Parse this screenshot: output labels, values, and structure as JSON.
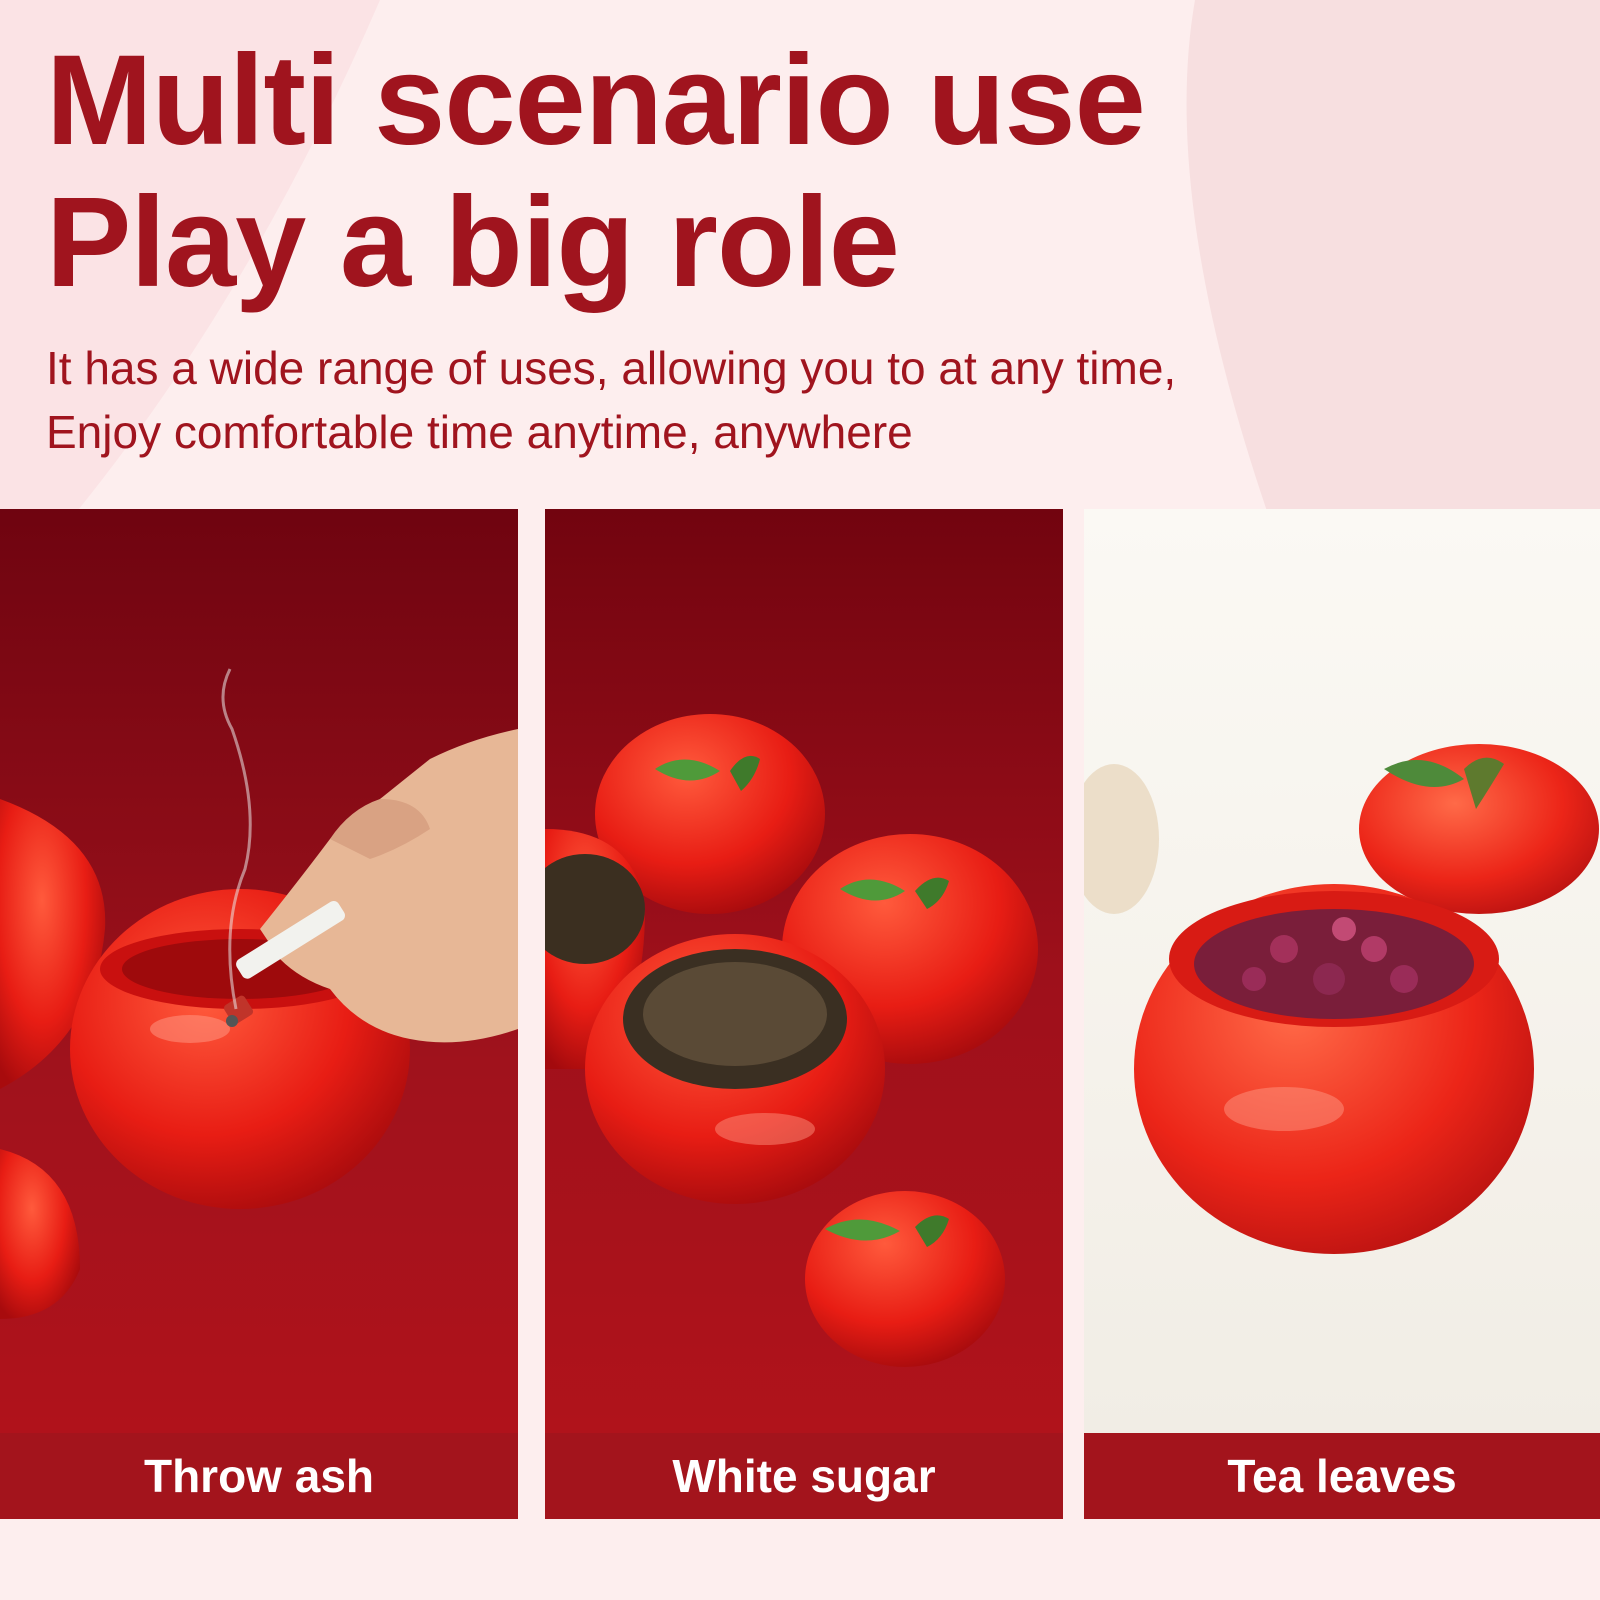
{
  "header": {
    "title_lines": [
      "Multi scenario use",
      "Play a big role"
    ],
    "subtitle_lines": [
      "It has a wide range of uses, allowing you to at any time,",
      "Enjoy comfortable time anytime, anywhere"
    ]
  },
  "panels": [
    {
      "caption": "Throw ash",
      "image": "red-apple-jar-ashtray-with-cigarette-photo"
    },
    {
      "caption": "White sugar",
      "image": "red-apple-jars-with-sunflower-seeds-photo"
    },
    {
      "caption": "Tea leaves",
      "image": "red-apple-jar-with-rose-tea-photo"
    }
  ],
  "colors": {
    "accent": "#a0141e",
    "background": "#fdeeee",
    "caption_bar": "#a3141c",
    "caption_text": "#ffffff"
  }
}
